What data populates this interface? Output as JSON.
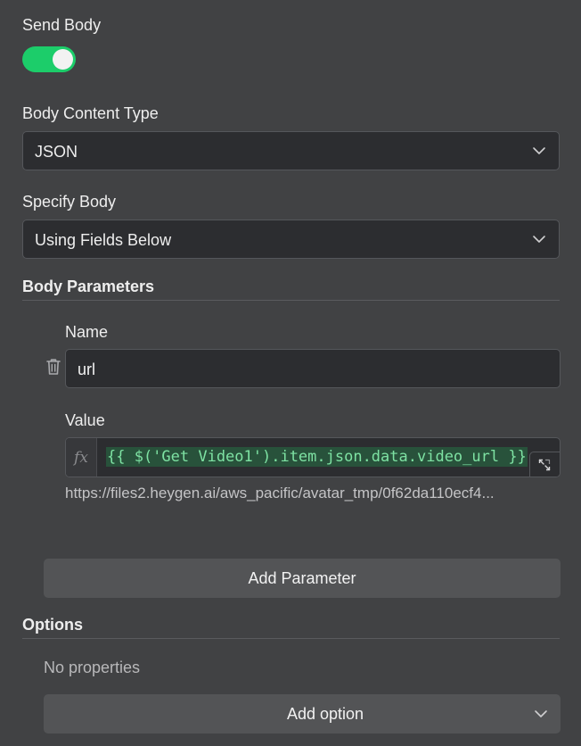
{
  "send_body": {
    "label": "Send Body",
    "enabled": true
  },
  "body_content_type": {
    "label": "Body Content Type",
    "value": "JSON"
  },
  "specify_body": {
    "label": "Specify Body",
    "value": "Using Fields Below"
  },
  "body_parameters": {
    "title": "Body Parameters",
    "items": [
      {
        "name_label": "Name",
        "name_value": "url",
        "value_label": "Value",
        "value_expression": "{{ $('Get Video1').item.json.data.video_url }}",
        "value_preview": "https://files2.heygen.ai/aws_pacific/avatar_tmp/0f62da110ecf4..."
      }
    ],
    "add_button": "Add Parameter"
  },
  "options": {
    "title": "Options",
    "empty_text": "No properties",
    "add_button": "Add option"
  },
  "colors": {
    "background": "#414244",
    "toggle_on": "#1ccd6a",
    "input_bg": "#2c2d30",
    "expression_text": "#7ee2a3",
    "expression_bg": "#28523b",
    "button_bg": "#535456"
  },
  "icons": {
    "trash": "trash-icon",
    "chevron": "chevron-down-icon",
    "expand": "expand-icon",
    "fx": "fx-icon"
  }
}
